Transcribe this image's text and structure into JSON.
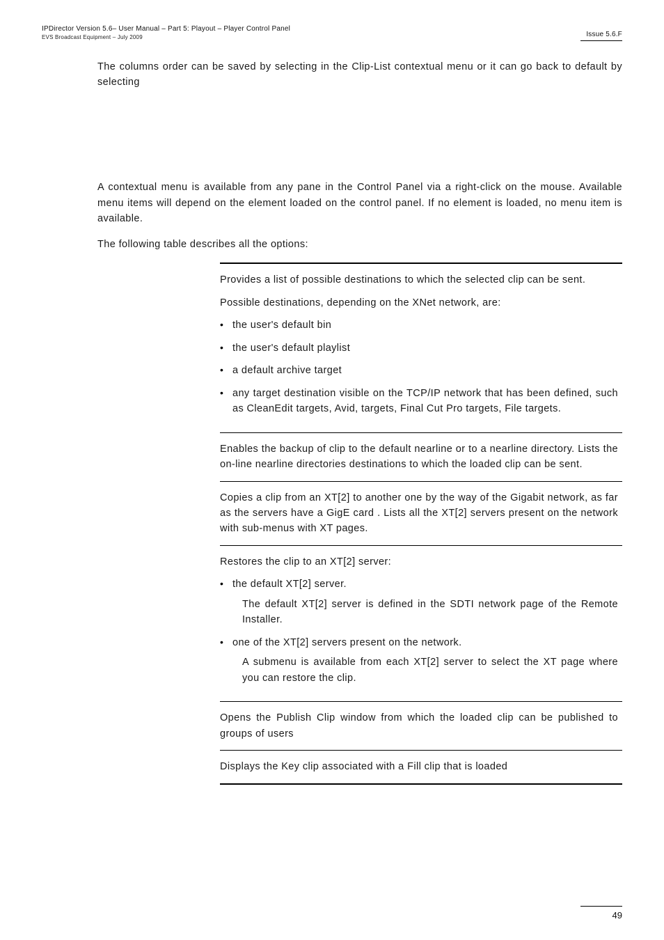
{
  "header": {
    "left_line1": "IPDirector Version 5.6– User Manual – Part 5: Playout – Player Control Panel",
    "left_line2": "EVS Broadcast Equipment – July 2009",
    "right": "Issue 5.6.F"
  },
  "intro": {
    "p1": "The columns order can be saved by selecting                                           in the Clip-List contextual menu or it can go back to default by selecting",
    "p2": "A contextual menu is available from any pane in the Control Panel via a right-click on the mouse. Available menu items will depend on the element loaded on the control panel. If no element is loaded, no menu item is available.",
    "p3": "The following table describes all the options:"
  },
  "rows": [
    {
      "paras": [
        "Provides a list of possible destinations to which the selected clip can be sent.",
        "Possible destinations, depending on the XNet network, are:"
      ],
      "bullets": [
        {
          "text": "the user's default bin"
        },
        {
          "text": "the user's default playlist"
        },
        {
          "text": "a default archive target"
        },
        {
          "text": "any target destination visible on the TCP/IP network that has been defined, such as CleanEdit targets, Avid, targets, Final Cut Pro targets, File targets."
        }
      ]
    },
    {
      "paras": [
        "Enables the backup of clip to the default nearline or to a nearline directory. Lists the on-line nearline directories destinations to which the loaded clip can be sent."
      ]
    },
    {
      "paras": [
        "Copies a clip from an XT[2] to another one by the way of the Gigabit network, as far as the servers have a GigE card . Lists all the XT[2] servers present on the network with sub-menus with XT pages."
      ]
    },
    {
      "paras": [
        "Restores the clip to an XT[2] server:"
      ],
      "bullets": [
        {
          "text": "the default XT[2] server.",
          "sub": "The default XT[2] server is defined in the SDTI network page of the Remote Installer."
        },
        {
          "text": "one of the XT[2] servers present on the network.",
          "sub": "A submenu is available from each XT[2] server to select the XT page where you can restore the clip."
        }
      ]
    },
    {
      "paras": [
        "Opens the Publish Clip window from which the loaded clip can be published to groups of users"
      ]
    },
    {
      "paras": [
        "Displays the Key clip associated with a Fill clip that is loaded"
      ]
    }
  ],
  "footer": {
    "page": "49"
  }
}
